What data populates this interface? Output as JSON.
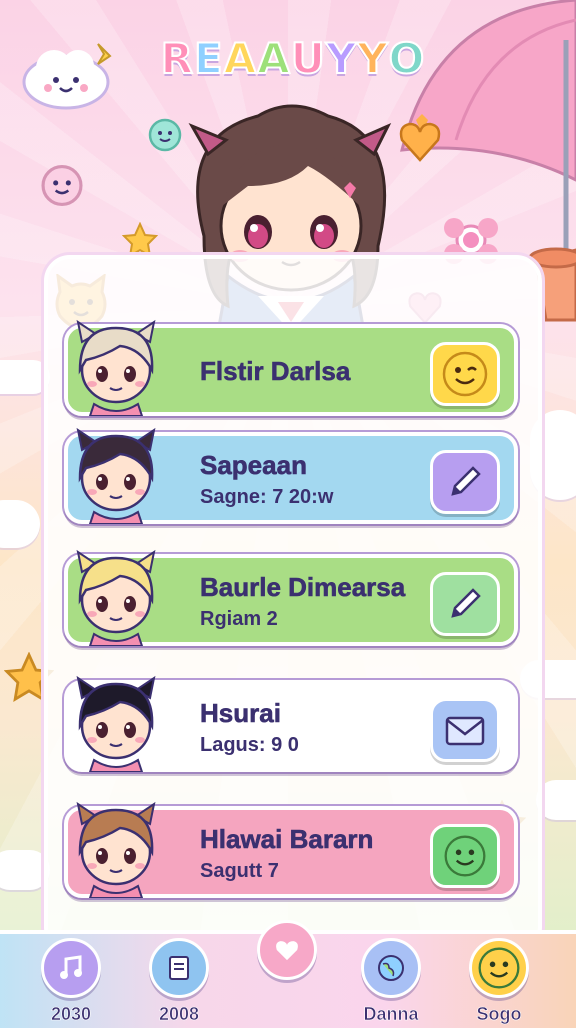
{
  "app": {
    "title": "REAAUYYO",
    "title_letters": [
      {
        "ch": "R",
        "color": "#ff8fb8"
      },
      {
        "ch": "E",
        "color": "#8fd0ff"
      },
      {
        "ch": "A",
        "color": "#ffd65c"
      },
      {
        "ch": "A",
        "color": "#9de07a"
      },
      {
        "ch": "U",
        "color": "#ff8fb8"
      },
      {
        "ch": "Y",
        "color": "#b89cff"
      },
      {
        "ch": "Y",
        "color": "#ffb45c"
      },
      {
        "ch": "O",
        "color": "#7fd7c9"
      }
    ]
  },
  "colors": {
    "accent": "#b69bd6",
    "text": "#3b3070",
    "green_card": "#a8e07e",
    "blue_card": "#9fd6ee",
    "white_card": "#ffffff",
    "pink_card": "#f6a3be"
  },
  "cards": [
    {
      "name": "Flstir Darlsa",
      "sub": "",
      "bg": "#a9dd85",
      "btn_color": "#ffd84a",
      "btn_icon": "wink-emoji-icon",
      "hair": "#e8dcc8"
    },
    {
      "name": "Sapeaan",
      "sub": "Sagne: 7 20:w",
      "bg": "#a3d8f0",
      "btn_color": "#b79ef0",
      "btn_icon": "pencil-icon",
      "hair": "#3a2a3a"
    },
    {
      "name": "Baurle Dimearsa",
      "sub": "Rgiam 2",
      "bg": "#a9dd85",
      "btn_color": "#9fe0a0",
      "btn_icon": "pencil-icon",
      "hair": "#f6e08a"
    },
    {
      "name": "Hsurai",
      "sub": "Lagus: 9 0",
      "bg": "#ffffff",
      "btn_color": "#a9c4f5",
      "btn_icon": "envelope-icon",
      "hair": "#1e1a2a"
    },
    {
      "name": "Hlawai Bararn",
      "sub": "Sagutt 7",
      "bg": "#f5a5bf",
      "btn_color": "#6fd27a",
      "btn_icon": "smile-emoji-icon",
      "hair": "#b87c52"
    }
  ],
  "nav": [
    {
      "label": "2030",
      "icon": "music-note-icon",
      "color": "#b79ef0"
    },
    {
      "label": "2008",
      "icon": "notepad-icon",
      "color": "#8fc4f0"
    },
    {
      "label": "",
      "icon": "heart-home-icon",
      "color": "#f7a8c8"
    },
    {
      "label": "Danna",
      "icon": "globe-icon",
      "color": "#a8c0f5"
    },
    {
      "label": "Sogo",
      "icon": "smile-emoji-icon",
      "color": "#ffd04a"
    }
  ]
}
